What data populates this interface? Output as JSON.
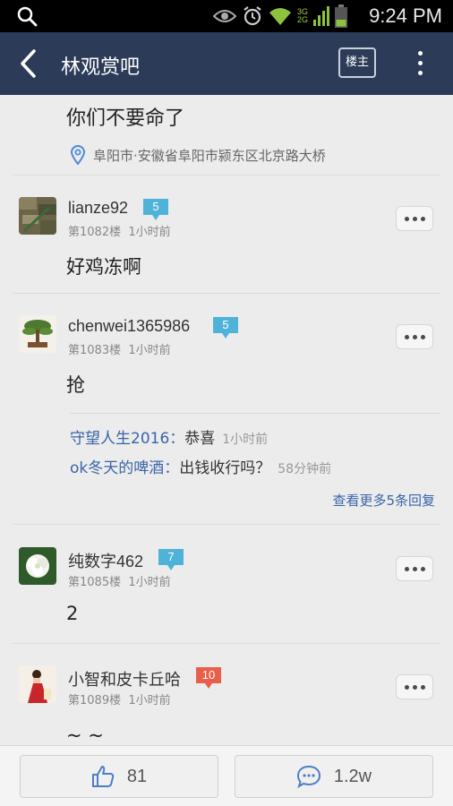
{
  "status_bar": {
    "time": "9:24 PM",
    "network_top": "3G",
    "network_bottom": "2G"
  },
  "nav": {
    "title": "林观赏吧",
    "owner_button": "楼主"
  },
  "intro": {
    "text": "你们不要命了",
    "location": "阜阳市·安徽省阜阳市颍东区北京路大桥"
  },
  "posts": [
    {
      "username": "lianze92",
      "level": "5",
      "floor": "第1082楼",
      "time": "1小时前",
      "body": "好鸡冻啊"
    },
    {
      "username": "chenwei1365986",
      "level": "5",
      "floor": "第1083楼",
      "time": "1小时前",
      "body": "抢",
      "replies": [
        {
          "name": "守望人生2016：",
          "text": "恭喜",
          "time": "1小时前"
        },
        {
          "name": "ok冬天的啤酒：",
          "text": "出钱收行吗？",
          "time": "58分钟前"
        }
      ],
      "more_replies": "查看更多5条回复"
    },
    {
      "username": "纯数字462",
      "level": "7",
      "floor": "第1085楼",
      "time": "1小时前",
      "body": "2"
    },
    {
      "username": "小智和皮卡丘哈",
      "level": "10",
      "floor": "第1089楼",
      "time": "1小时前",
      "body": "~ ~"
    }
  ],
  "bottom": {
    "like_count": "81",
    "comment_count": "1.2w"
  },
  "colors": {
    "nav_bg": "#2c3b57",
    "level_blue": "#4fb3d9",
    "level_red": "#e8604c",
    "link_blue": "#3a64a8"
  }
}
